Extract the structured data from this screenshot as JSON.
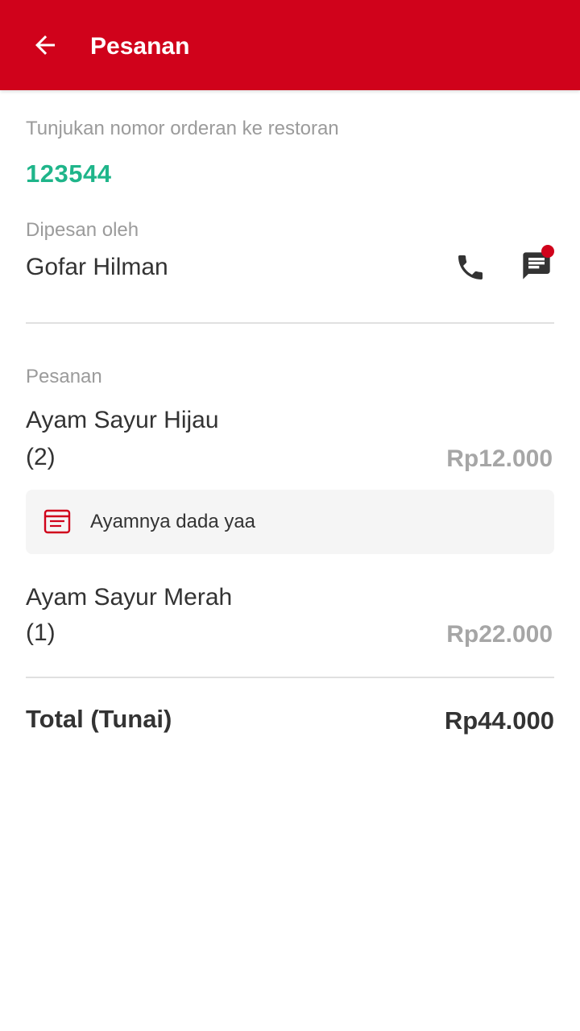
{
  "header": {
    "title": "Pesanan",
    "back_icon": "arrow-left-icon",
    "background_color": "#D0021B"
  },
  "order": {
    "prompt": "Tunjukan nomor orderan ke restoran",
    "number": "123544",
    "number_color": "#1FB58A"
  },
  "customer": {
    "label": "Dipesan oleh",
    "name": "Gofar Hilman",
    "call_icon": "phone-icon",
    "chat_icon": "chat-icon",
    "chat_unread_indicator": true
  },
  "items_section": {
    "label": "Pesanan",
    "items": [
      {
        "name": "Ayam Sayur Hijau",
        "qty": "(2)",
        "price": "Rp12.000",
        "note": "Ayamnya dada yaa",
        "note_icon": "receipt-icon"
      },
      {
        "name": "Ayam Sayur Merah",
        "qty": "(1)",
        "price": "Rp22.000"
      }
    ]
  },
  "total": {
    "label": "Total (Tunai)",
    "value": "Rp44.000"
  }
}
